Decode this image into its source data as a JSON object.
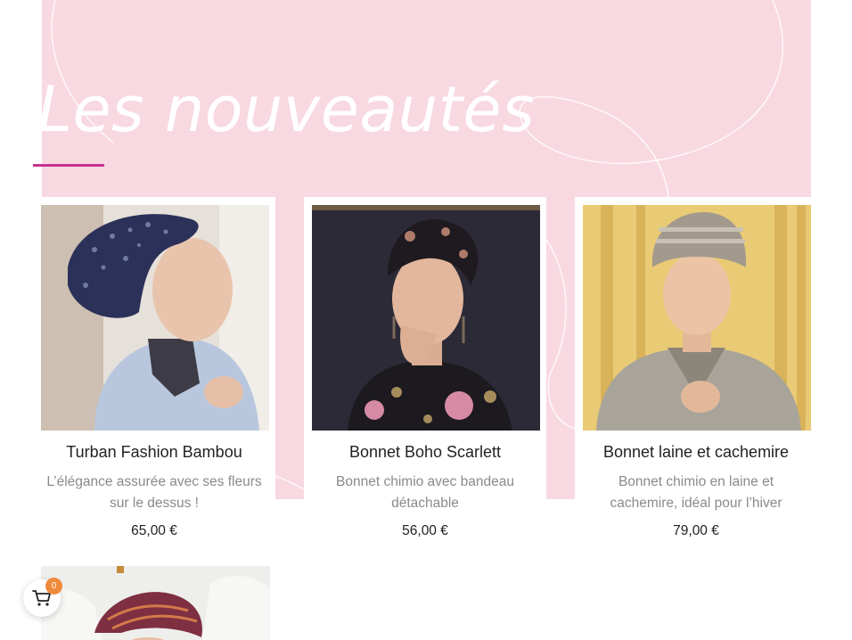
{
  "section": {
    "title": "Les nouveautés"
  },
  "products": [
    {
      "name": "Turban Fashion Bambou",
      "description_lines": [
        "L’élégance assurée avec ses fleurs",
        "sur le dessus !"
      ],
      "price": "65,00 €"
    },
    {
      "name": "Bonnet Boho Scarlett",
      "description_lines": [
        "Bonnet chimio avec bandeau",
        "détachable"
      ],
      "price": "56,00 €"
    },
    {
      "name": "Bonnet laine et cachemire",
      "description_lines": [
        "Bonnet chimio en laine et",
        "cachemire, idéal pour l’hiver"
      ],
      "price": "79,00 €"
    }
  ],
  "cart": {
    "count": "0",
    "icon": "cart-icon"
  },
  "colors": {
    "hero_background": "#f8d9e1",
    "accent_underline": "#c7318f",
    "badge": "#ee8a3c",
    "product_name": "#222222",
    "product_description": "#8a8a8a"
  }
}
